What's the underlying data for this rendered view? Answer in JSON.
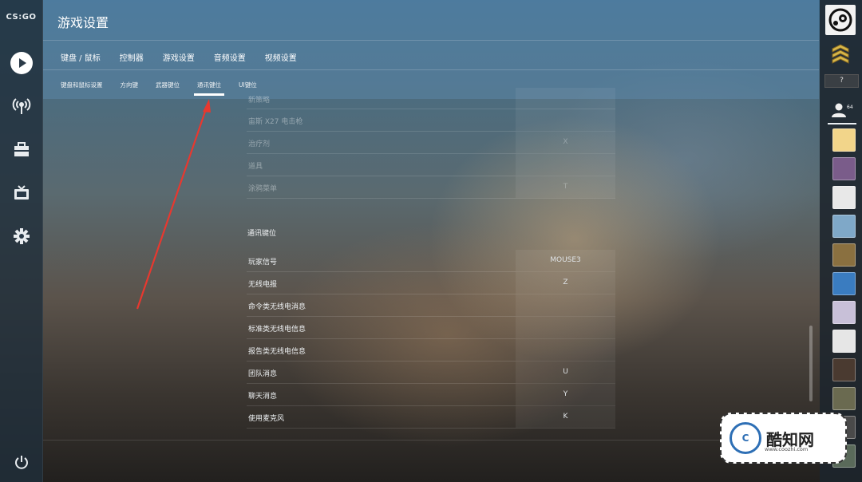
{
  "app": {
    "logo_text": "CS:GO"
  },
  "header": {
    "title": "游戏设置",
    "tabs": [
      "键盘 / 鼠标",
      "控制器",
      "游戏设置",
      "音频设置",
      "视频设置"
    ],
    "subtabs": [
      "键盘和鼠标设置",
      "方向键",
      "武器键位",
      "通讯键位",
      "UI键位"
    ],
    "active_subtab": "通讯键位"
  },
  "sidebar_left": {
    "icons": [
      "play-icon",
      "broadcast-icon",
      "inventory-icon",
      "tv-icon",
      "gear-icon",
      "power-icon"
    ]
  },
  "list_top": [
    {
      "label": "新策略",
      "key": ""
    },
    {
      "label": "宙斯 X27 电击枪",
      "key": ""
    },
    {
      "label": "治疗剂",
      "key": "X"
    },
    {
      "label": "道具",
      "key": ""
    },
    {
      "label": "涂鸦菜单",
      "key": "T"
    }
  ],
  "section": {
    "title": "通讯键位"
  },
  "list_comm": [
    {
      "label": "玩家信号",
      "key": "MOUSE3"
    },
    {
      "label": "无线电报",
      "key": "Z"
    },
    {
      "label": "命令类无线电消息",
      "key": ""
    },
    {
      "label": "标准类无线电信息",
      "key": ""
    },
    {
      "label": "报告类无线电信息",
      "key": ""
    },
    {
      "label": "团队消息",
      "key": "U"
    },
    {
      "label": "聊天消息",
      "key": "Y"
    },
    {
      "label": "使用麦克风",
      "key": "K"
    }
  ],
  "sidebar_right": {
    "unknown_rank": "?",
    "friends_count": "64",
    "avatar_colors": [
      "#f2d58a",
      "#7a5c8a",
      "#e8e8e8",
      "#7fa8c8",
      "#8a7040",
      "#3a7cc0",
      "#c8c0d8",
      "#e6e6e6",
      "#4a3a30",
      "#6a6a50",
      "#4a4a4a",
      "#5a6a5a"
    ]
  },
  "watermark": {
    "name": "酷知网",
    "url": "www.coozhi.com",
    "badge": "C"
  }
}
